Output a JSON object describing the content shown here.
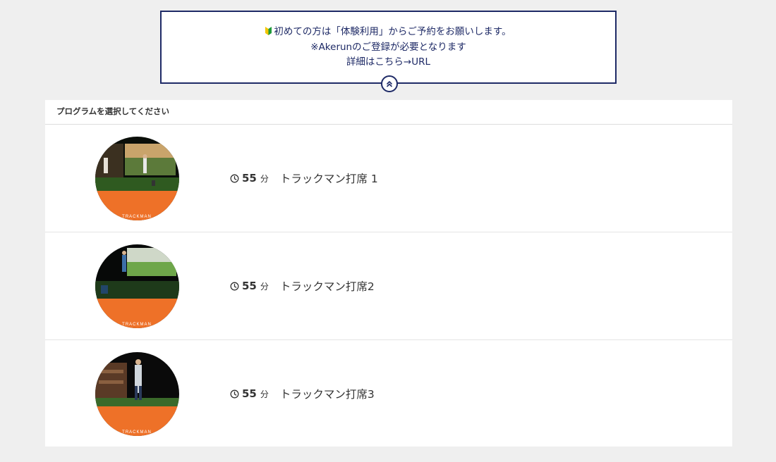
{
  "notice": {
    "line1": "初めての方は「体験利用」からご予約をお願いします。",
    "line2": "※Akerunのご登録が必要となります",
    "line3": "詳細はこちら→URL",
    "icons": {
      "beginner": "beginner-mark-icon",
      "collapse": "chevrons-up-icon"
    }
  },
  "programs": {
    "header": "プログラムを選択してください",
    "items": [
      {
        "duration": "55",
        "unit": "分",
        "name": "トラックマン打席 1",
        "thumb_label": "TRACKMAN"
      },
      {
        "duration": "55",
        "unit": "分",
        "name": "トラックマン打席2",
        "thumb_label": "TRACKMAN"
      },
      {
        "duration": "55",
        "unit": "分",
        "name": "トラックマン打席3",
        "thumb_label": "TRACKMAN"
      }
    ]
  },
  "colors": {
    "accent": "#1e2a66",
    "background": "#efefef",
    "trackman_orange": "#ee7128"
  }
}
